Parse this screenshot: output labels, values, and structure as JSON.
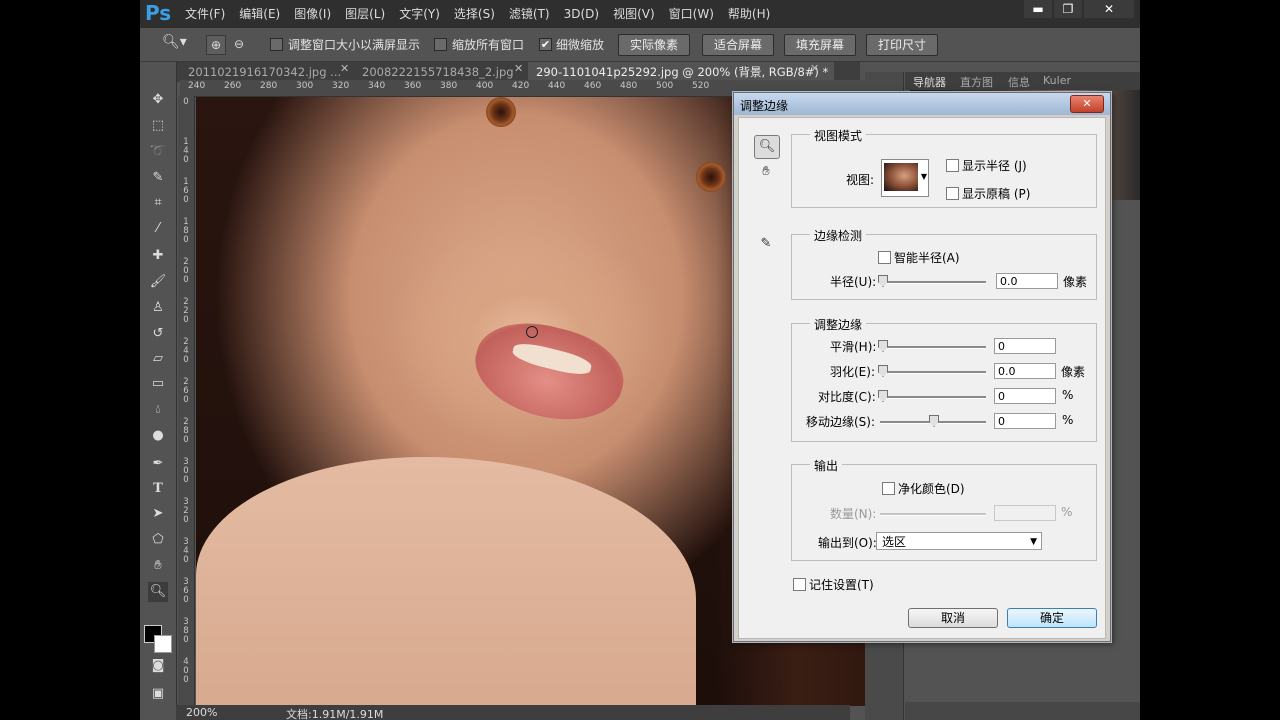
{
  "app": {
    "logo": "Ps"
  },
  "menu": [
    "文件(F)",
    "编辑(E)",
    "图像(I)",
    "图层(L)",
    "文字(Y)",
    "选择(S)",
    "滤镜(T)",
    "3D(D)",
    "视图(V)",
    "窗口(W)",
    "帮助(H)"
  ],
  "window_controls": {
    "minimize": "▬",
    "restore": "❐",
    "close": "✕"
  },
  "options": {
    "resize_windows": "调整窗口大小以满屏显示",
    "zoom_all": "缩放所有窗口",
    "scrubby_zoom": "细微缩放",
    "actual_pixels": "实际像素",
    "fit_screen": "适合屏幕",
    "fill_screen": "填充屏幕",
    "print_size": "打印尺寸"
  },
  "tabs": [
    {
      "label": "2011021916170342.jpg ..."
    },
    {
      "label": "2008222155718438_2.jpg"
    },
    {
      "label": "290-1101041p25292.jpg @ 200% (背景, RGB/8#) *"
    }
  ],
  "ruler_top": [
    "240",
    "260",
    "280",
    "300",
    "320",
    "340",
    "360",
    "380",
    "400",
    "420",
    "440",
    "460",
    "480",
    "500",
    "520"
  ],
  "ruler_left": [
    "0",
    "140",
    "160",
    "180",
    "200",
    "220",
    "240",
    "260",
    "280",
    "300",
    "320",
    "340",
    "360",
    "380",
    "400"
  ],
  "status": {
    "zoom": "200%",
    "doc": "文档:1.91M/1.91M"
  },
  "panels": {
    "tabs": [
      "导航器",
      "直方图",
      "信息",
      "Kuler"
    ]
  },
  "dialog": {
    "title": "调整边缘",
    "close": "✕",
    "view_mode": {
      "title": "视图模式",
      "view_label": "视图:",
      "show_radius": "显示半径 (J)",
      "show_original": "显示原稿 (P)"
    },
    "edge_detection": {
      "title": "边缘检测",
      "smart_radius": "智能半径(A)",
      "radius_label": "半径(U):",
      "radius_value": "0.0",
      "radius_unit": "像素"
    },
    "adjust_edge": {
      "title": "调整边缘",
      "smooth_label": "平滑(H):",
      "smooth_value": "0",
      "feather_label": "羽化(E):",
      "feather_value": "0.0",
      "feather_unit": "像素",
      "contrast_label": "对比度(C):",
      "contrast_value": "0",
      "contrast_unit": "%",
      "shift_label": "移动边缘(S):",
      "shift_value": "0",
      "shift_unit": "%"
    },
    "output": {
      "title": "输出",
      "decontaminate": "净化颜色(D)",
      "amount_label": "数量(N):",
      "amount_unit": "%",
      "output_to_label": "输出到(O):",
      "output_to_value": "选区"
    },
    "remember": "记住设置(T)",
    "cancel": "取消",
    "ok": "确定"
  }
}
